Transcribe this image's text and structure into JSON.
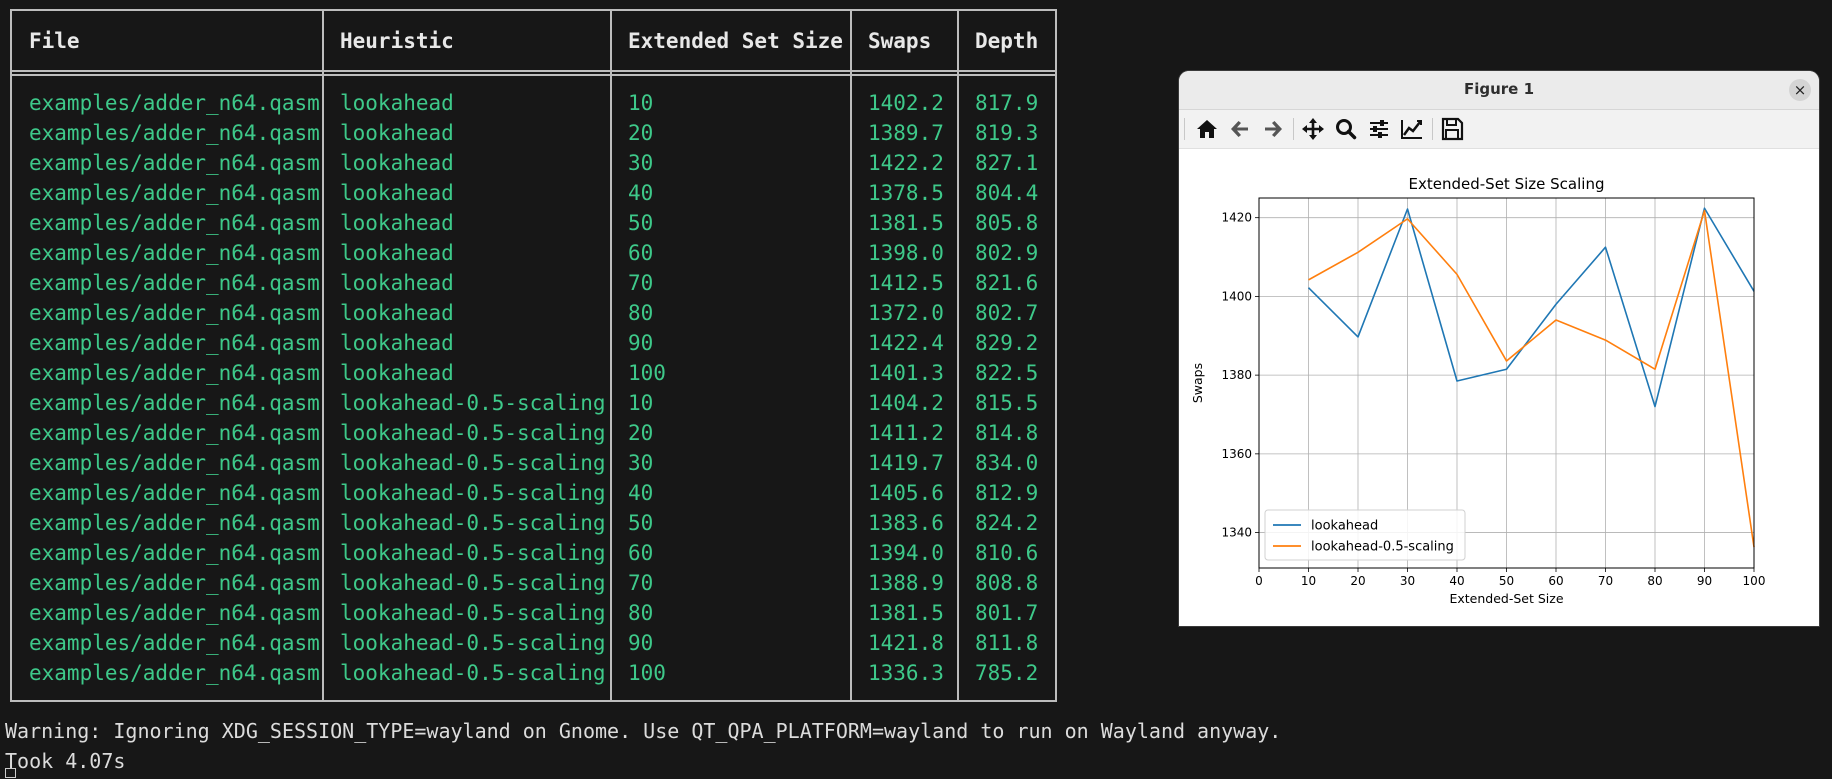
{
  "terminal": {
    "headers": [
      "File",
      "Heuristic",
      "Extended Set Size",
      "Swaps",
      "Depth"
    ],
    "rows": [
      [
        "examples/adder_n64.qasm",
        "lookahead",
        "10",
        "1402.2",
        "817.9"
      ],
      [
        "examples/adder_n64.qasm",
        "lookahead",
        "20",
        "1389.7",
        "819.3"
      ],
      [
        "examples/adder_n64.qasm",
        "lookahead",
        "30",
        "1422.2",
        "827.1"
      ],
      [
        "examples/adder_n64.qasm",
        "lookahead",
        "40",
        "1378.5",
        "804.4"
      ],
      [
        "examples/adder_n64.qasm",
        "lookahead",
        "50",
        "1381.5",
        "805.8"
      ],
      [
        "examples/adder_n64.qasm",
        "lookahead",
        "60",
        "1398.0",
        "802.9"
      ],
      [
        "examples/adder_n64.qasm",
        "lookahead",
        "70",
        "1412.5",
        "821.6"
      ],
      [
        "examples/adder_n64.qasm",
        "lookahead",
        "80",
        "1372.0",
        "802.7"
      ],
      [
        "examples/adder_n64.qasm",
        "lookahead",
        "90",
        "1422.4",
        "829.2"
      ],
      [
        "examples/adder_n64.qasm",
        "lookahead",
        "100",
        "1401.3",
        "822.5"
      ],
      [
        "examples/adder_n64.qasm",
        "lookahead-0.5-scaling",
        "10",
        "1404.2",
        "815.5"
      ],
      [
        "examples/adder_n64.qasm",
        "lookahead-0.5-scaling",
        "20",
        "1411.2",
        "814.8"
      ],
      [
        "examples/adder_n64.qasm",
        "lookahead-0.5-scaling",
        "30",
        "1419.7",
        "834.0"
      ],
      [
        "examples/adder_n64.qasm",
        "lookahead-0.5-scaling",
        "40",
        "1405.6",
        "812.9"
      ],
      [
        "examples/adder_n64.qasm",
        "lookahead-0.5-scaling",
        "50",
        "1383.6",
        "824.2"
      ],
      [
        "examples/adder_n64.qasm",
        "lookahead-0.5-scaling",
        "60",
        "1394.0",
        "810.6"
      ],
      [
        "examples/adder_n64.qasm",
        "lookahead-0.5-scaling",
        "70",
        "1388.9",
        "808.8"
      ],
      [
        "examples/adder_n64.qasm",
        "lookahead-0.5-scaling",
        "80",
        "1381.5",
        "801.7"
      ],
      [
        "examples/adder_n64.qasm",
        "lookahead-0.5-scaling",
        "90",
        "1421.8",
        "811.8"
      ],
      [
        "examples/adder_n64.qasm",
        "lookahead-0.5-scaling",
        "100",
        "1336.3",
        "785.2"
      ]
    ],
    "warning": "Warning: Ignoring XDG_SESSION_TYPE=wayland on Gnome. Use QT_QPA_PLATFORM=wayland to run on Wayland anyway.",
    "took": "Took 4.07s",
    "text_color": "#3ec98a"
  },
  "window": {
    "title": "Figure 1",
    "close_glyph": "×",
    "toolbar_icons": [
      "home-icon",
      "back-arrow-icon",
      "forward-arrow-icon",
      "pan-icon",
      "zoom-icon",
      "configure-subplots-icon",
      "edit-axis-icon",
      "save-icon"
    ]
  },
  "chart_data": {
    "type": "line",
    "title": "Extended-Set Size Scaling",
    "xlabel": "Extended-Set Size",
    "ylabel": "Swaps",
    "xlim": [
      0,
      100
    ],
    "ylim": [
      1331,
      1425
    ],
    "xticks": [
      0,
      10,
      20,
      30,
      40,
      50,
      60,
      70,
      80,
      90,
      100
    ],
    "yticks": [
      1340,
      1360,
      1380,
      1400,
      1420
    ],
    "grid": true,
    "legend_position": "lower-left",
    "x": [
      10,
      20,
      30,
      40,
      50,
      60,
      70,
      80,
      90,
      100
    ],
    "series": [
      {
        "name": "lookahead",
        "color": "#1f77b4",
        "values": [
          1402.2,
          1389.7,
          1422.2,
          1378.5,
          1381.5,
          1398.0,
          1412.5,
          1372.0,
          1422.4,
          1401.3
        ]
      },
      {
        "name": "lookahead-0.5-scaling",
        "color": "#ff7f0e",
        "values": [
          1404.2,
          1411.2,
          1419.7,
          1405.6,
          1383.6,
          1394.0,
          1388.9,
          1381.5,
          1421.8,
          1336.3
        ]
      }
    ]
  }
}
